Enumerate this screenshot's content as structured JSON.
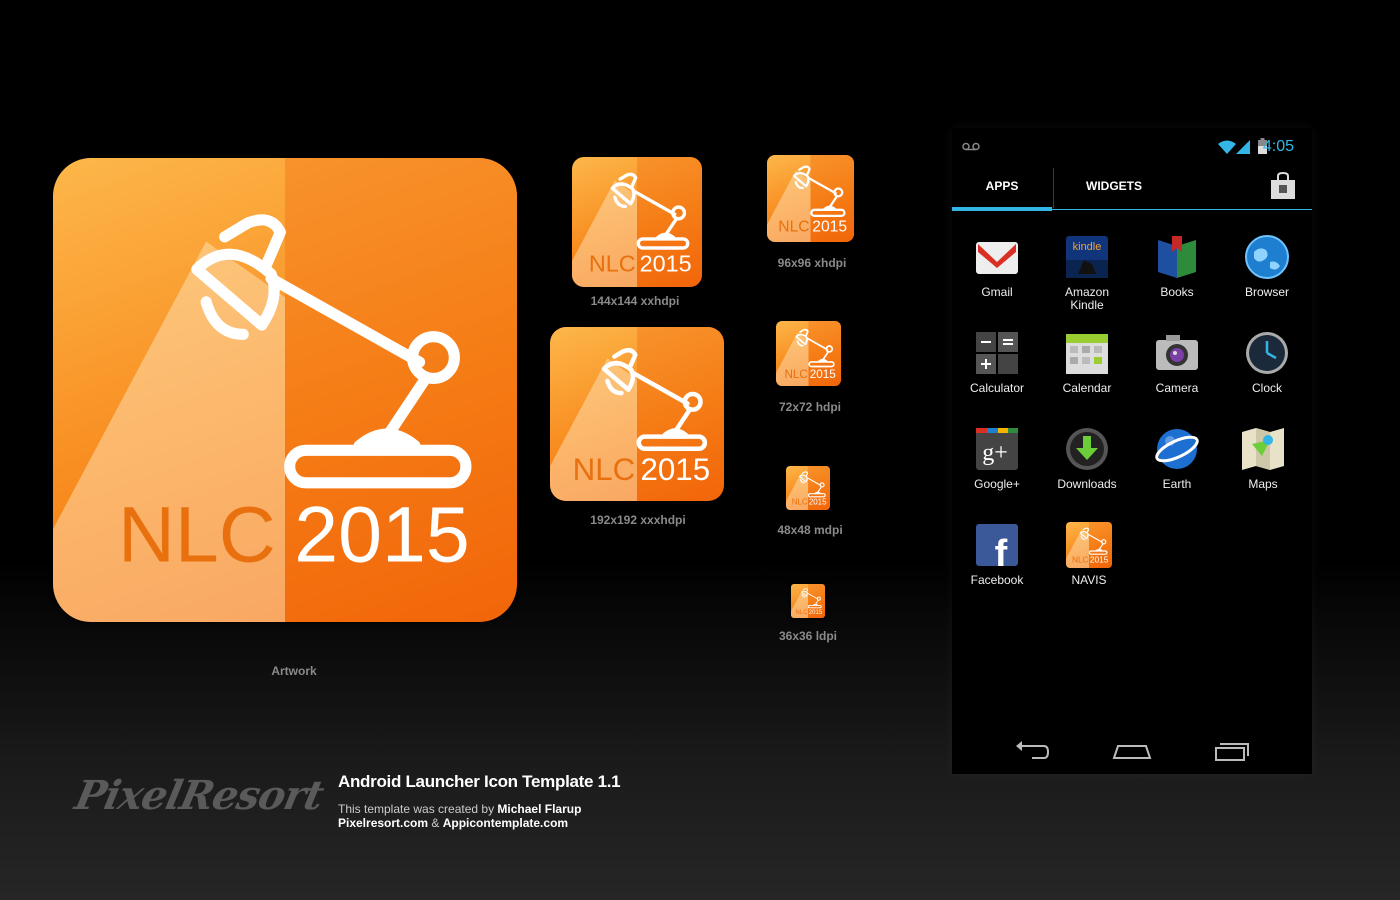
{
  "icon_text": {
    "nlc": "NLC",
    "year": "2015"
  },
  "artwork_label": "Artwork",
  "icon_sizes": [
    {
      "label": "144x144 xxhdpi"
    },
    {
      "label": "192x192 xxxhdpi"
    },
    {
      "label": "96x96 xhdpi"
    },
    {
      "label": "72x72 hdpi"
    },
    {
      "label": "48x48 mdpi"
    },
    {
      "label": "36x36 ldpi"
    }
  ],
  "phone": {
    "status": {
      "time": "4:05",
      "voicemail_icon": "voicemail-icon",
      "wifi_icon": "wifi-icon",
      "signal_icon": "signal-icon",
      "battery_icon": "battery-icon"
    },
    "tabs": {
      "apps": "APPS",
      "widgets": "WIDGETS",
      "store_icon": "shopping-bag-icon"
    },
    "apps": [
      {
        "label": "Gmail",
        "icon": "gmail-icon"
      },
      {
        "label": "Amazon Kindle",
        "icon": "kindle-icon",
        "icon_text": "kindle"
      },
      {
        "label": "Books",
        "icon": "books-icon"
      },
      {
        "label": "Browser",
        "icon": "browser-icon"
      },
      {
        "label": "Calculator",
        "icon": "calculator-icon"
      },
      {
        "label": "Calendar",
        "icon": "calendar-icon"
      },
      {
        "label": "Camera",
        "icon": "camera-icon"
      },
      {
        "label": "Clock",
        "icon": "clock-icon"
      },
      {
        "label": "Google+",
        "icon": "google-plus-icon",
        "icon_text": "g+"
      },
      {
        "label": "Downloads",
        "icon": "downloads-icon"
      },
      {
        "label": "Earth",
        "icon": "earth-icon"
      },
      {
        "label": "Maps",
        "icon": "maps-icon"
      },
      {
        "label": "Facebook",
        "icon": "facebook-icon",
        "icon_text": "f"
      },
      {
        "label": "NAVIS",
        "icon": "navis-icon"
      }
    ],
    "nav": {
      "back_icon": "back-icon",
      "home_icon": "home-icon",
      "recents_icon": "recents-icon"
    }
  },
  "branding": {
    "logo": "PixelResort",
    "title": "Android Launcher Icon Template 1.1",
    "credit_prefix": "This template was created by ",
    "author": "Michael Flarup",
    "site1": "Pixelresort.com",
    "amp": " & ",
    "site2": "Appicontemplate.com"
  },
  "colors": {
    "accent": "#33b5e5",
    "icon_orange_light": "#fdb74a",
    "icon_orange_dark": "#f2660a"
  }
}
